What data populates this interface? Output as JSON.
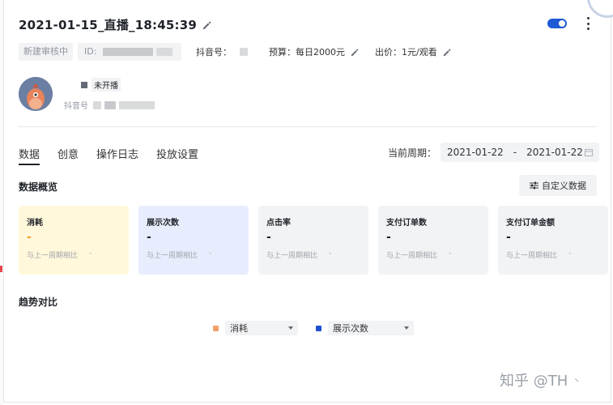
{
  "header": {
    "title": "2021-01-15_直播_18:45:39"
  },
  "meta": {
    "status_tag": "新建审核中",
    "id_label": "ID:",
    "douyin_label": "抖音号：",
    "budget": "预算：每日2000元",
    "bid": "出价：1元/观看"
  },
  "account": {
    "status": "未开播",
    "douyin_id_prefix": "抖音号"
  },
  "tabs": [
    {
      "label": "数据"
    },
    {
      "label": "创意"
    },
    {
      "label": "操作日志"
    },
    {
      "label": "投放设置"
    }
  ],
  "period": {
    "label": "当前周期：",
    "start": "2021-01-22",
    "separator": "-",
    "end": "2021-01-22"
  },
  "overview": {
    "title": "数据概览",
    "custom_button": "自定义数据",
    "cards": [
      {
        "title": "消耗",
        "value": "-",
        "compare_label": "与上一周期相比",
        "compare_value": "-"
      },
      {
        "title": "展示次数",
        "value": "-",
        "compare_label": "与上一周期相比",
        "compare_value": "-"
      },
      {
        "title": "点击率",
        "value": "-",
        "compare_label": "与上一周期相比",
        "compare_value": "-"
      },
      {
        "title": "支付订单数",
        "value": "-",
        "compare_label": "与上一周期相比",
        "compare_value": "-"
      },
      {
        "title": "支付订单金额",
        "value": "-",
        "compare_label": "与上一周期相比",
        "compare_value": "-"
      }
    ]
  },
  "trend": {
    "title": "趋势对比",
    "metric1": {
      "label": "消耗",
      "color": "#f0a06a"
    },
    "metric2": {
      "label": "展示次数",
      "color": "#1e4fd0"
    }
  },
  "watermark": {
    "text": "知乎 @TH",
    "suffix": "丶"
  },
  "colors": {
    "toggle": "#1e5ad6",
    "card_yellow": "#fff8db",
    "card_blue": "#e8edfd",
    "card_gray": "#f2f3f5"
  }
}
